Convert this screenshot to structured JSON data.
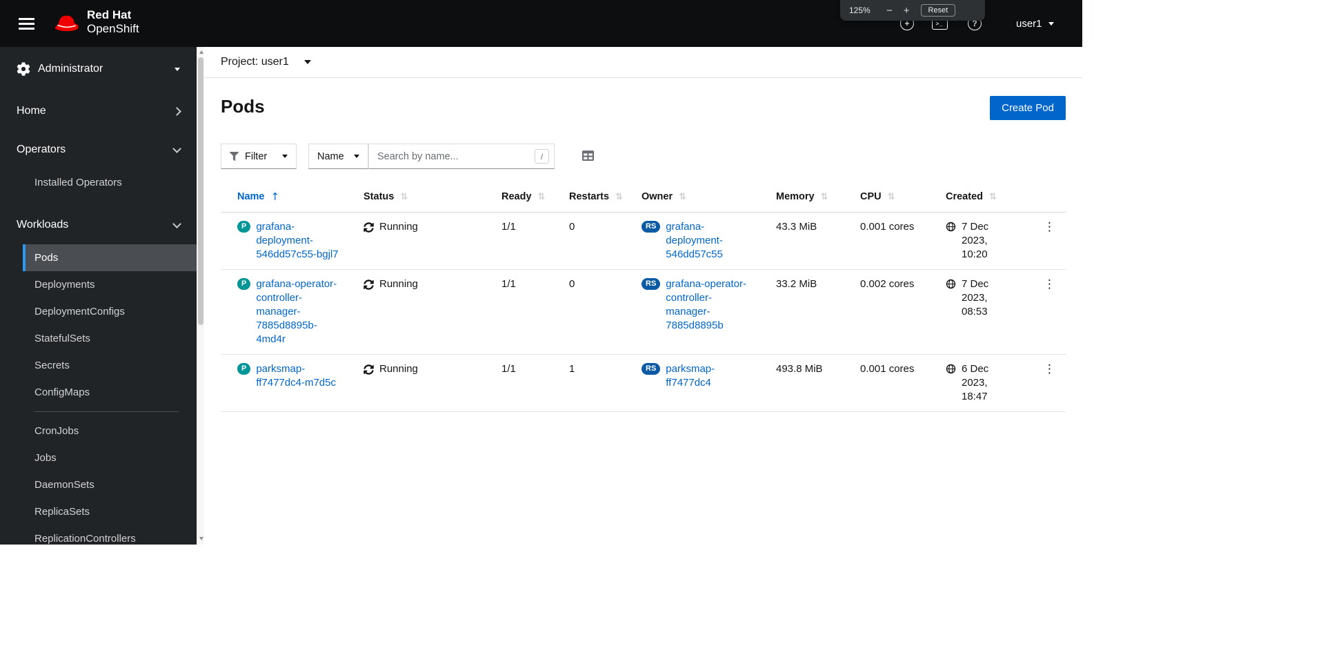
{
  "masthead": {
    "brand_line1": "Red Hat",
    "brand_line2": "OpenShift",
    "user_menu": "user1"
  },
  "zoom_overlay": {
    "level": "125%",
    "minus": "−",
    "plus": "+",
    "reset_label": "Reset"
  },
  "glyphs": {
    "plus_circle": "+",
    "terminal": "&gt;_",
    "terminal_text": ">_",
    "question": "?",
    "kebab": "⋮",
    "sort_ascending": "↑",
    "sort_both": "⇅"
  },
  "sidebar": {
    "perspective": "Administrator",
    "home_label": "Home",
    "operators_label": "Operators",
    "workloads_label": "Workloads",
    "operators_children": [
      "Installed Operators"
    ],
    "workloads_children": [
      "Pods",
      "Deployments",
      "DeploymentConfigs",
      "StatefulSets",
      "Secrets",
      "ConfigMaps",
      "CronJobs",
      "Jobs",
      "DaemonSets",
      "ReplicaSets",
      "ReplicationControllers"
    ],
    "selected_item": "Pods"
  },
  "project_bar": {
    "label": "Project: user1"
  },
  "page": {
    "title": "Pods",
    "create_button": "Create Pod"
  },
  "toolbar": {
    "filter_label": "Filter",
    "attribute_label": "Name",
    "search_placeholder": "Search by name...",
    "shortcut_hint": "/"
  },
  "table": {
    "columns": [
      "Name",
      "Status",
      "Ready",
      "Restarts",
      "Owner",
      "Memory",
      "CPU",
      "Created"
    ],
    "sorted_by": "Name",
    "sort_direction": "ascending",
    "rows": [
      {
        "badge": "P",
        "name": "grafana-deployment-546dd57c55-bgjl7",
        "status": "Running",
        "ready": "1/1",
        "restarts": "0",
        "owner_badge": "RS",
        "owner": "grafana-deployment-546dd57c55",
        "memory": "43.3 MiB",
        "cpu": "0.001 cores",
        "created_date": "7 Dec 2023,",
        "created_time": "10:20"
      },
      {
        "badge": "P",
        "name": "grafana-operator-controller-manager-7885d8895b-4md4r",
        "status": "Running",
        "ready": "1/1",
        "restarts": "0",
        "owner_badge": "RS",
        "owner": "grafana-operator-controller-manager-7885d8895b",
        "memory": "33.2 MiB",
        "cpu": "0.002 cores",
        "created_date": "7 Dec 2023,",
        "created_time": "08:53"
      },
      {
        "badge": "P",
        "name": "parksmap-ff7477dc4-m7d5c",
        "status": "Running",
        "ready": "1/1",
        "restarts": "1",
        "owner_badge": "RS",
        "owner": "parksmap-ff7477dc4",
        "memory": "493.8 MiB",
        "cpu": "0.001 cores",
        "created_date": "6 Dec 2023,",
        "created_time": "18:47"
      }
    ]
  },
  "colors": {
    "accent_blue": "#0066cc",
    "pod_badge": "#009596",
    "replicaset_badge": "#0a5aa4",
    "masthead_bg": "#0c0e10",
    "sidebar_bg": "#212427",
    "selected_nav_bg": "#4a4e52",
    "selected_nav_border": "#2b9af3"
  }
}
